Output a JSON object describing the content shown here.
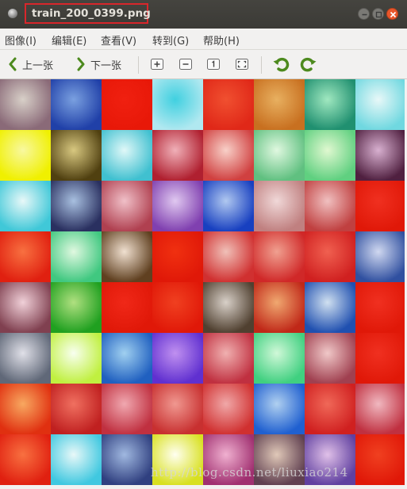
{
  "window": {
    "title": "train_200_0399.png"
  },
  "menu": {
    "items": [
      {
        "label": "图像(I)"
      },
      {
        "label": "编辑(E)"
      },
      {
        "label": "查看(V)"
      },
      {
        "label": "转到(G)"
      },
      {
        "label": "帮助(H)"
      }
    ]
  },
  "toolbar": {
    "prev_label": "上一张",
    "next_label": "下一张",
    "icons": [
      "zoom-in-icon",
      "zoom-out-icon",
      "normal-size-icon",
      "best-fit-icon",
      "rotate-left-icon",
      "rotate-right-icon"
    ]
  },
  "watermark": {
    "text": "http://blog.csdn.net/liuxiao214"
  },
  "image": {
    "rows": 8,
    "cols": 8,
    "tiles": [
      [
        [
          "#8a6a78",
          "#d8d0c8"
        ],
        [
          "#2040a8",
          "#7aa0e0"
        ],
        [
          "#e81808",
          "#f02010"
        ],
        [
          "#b0e8f0",
          "#40d0e0"
        ],
        [
          "#e02818",
          "#f05030"
        ],
        [
          "#c87020",
          "#e8b060"
        ],
        [
          "#209070",
          "#a0e8c0"
        ],
        [
          "#70d8e0",
          "#e8f8f8"
        ]
      ],
      [
        [
          "#f0f000",
          "#f8f8a0"
        ],
        [
          "#504010",
          "#d8c880"
        ],
        [
          "#40c0d0",
          "#e0f8f8"
        ],
        [
          "#b02030",
          "#f0b0b8"
        ],
        [
          "#d04040",
          "#f8d0c8"
        ],
        [
          "#60c080",
          "#e0f8e0"
        ],
        [
          "#60d080",
          "#e0f8d0"
        ],
        [
          "#502040",
          "#d8b0d0"
        ]
      ],
      [
        [
          "#40c8d8",
          "#e8f8f8"
        ],
        [
          "#2a3060",
          "#a8c0e0"
        ],
        [
          "#b04050",
          "#f0c0c8"
        ],
        [
          "#8040b0",
          "#e0c8f0"
        ],
        [
          "#1840c0",
          "#b0c8f0"
        ],
        [
          "#c08080",
          "#f0d8d8"
        ],
        [
          "#c04040",
          "#f0c0c0"
        ],
        [
          "#e01808",
          "#f03020"
        ]
      ],
      [
        [
          "#e02010",
          "#f87040"
        ],
        [
          "#40c880",
          "#e0f8e0"
        ],
        [
          "#604020",
          "#f0e0d0"
        ],
        [
          "#e01808",
          "#f03010"
        ],
        [
          "#d03030",
          "#f0c0b8"
        ],
        [
          "#d02828",
          "#f0a090"
        ],
        [
          "#d02020",
          "#f06050"
        ],
        [
          "#3050a0",
          "#d0d8f0"
        ]
      ],
      [
        [
          "#804050",
          "#f0d0d8"
        ],
        [
          "#20a020",
          "#b0e080"
        ],
        [
          "#e01808",
          "#f02818"
        ],
        [
          "#e01808",
          "#f04020"
        ],
        [
          "#504030",
          "#d8d0c8"
        ],
        [
          "#c02818",
          "#f0a870"
        ],
        [
          "#2050b0",
          "#d0e0f0"
        ],
        [
          "#e01808",
          "#f03020"
        ]
      ],
      [
        [
          "#606878",
          "#e0e0e8"
        ],
        [
          "#c0f040",
          "#f8fff0"
        ],
        [
          "#2060c0",
          "#a0d0f0"
        ],
        [
          "#6030d0",
          "#c090f0"
        ],
        [
          "#c03040",
          "#f0b0b0"
        ],
        [
          "#40d080",
          "#d0f8d8"
        ],
        [
          "#a04050",
          "#f0c8c8"
        ],
        [
          "#e01808",
          "#f03020"
        ]
      ],
      [
        [
          "#e03010",
          "#f8a860"
        ],
        [
          "#c02020",
          "#f07060"
        ],
        [
          "#c03040",
          "#f0a8b0"
        ],
        [
          "#c83030",
          "#f09890"
        ],
        [
          "#d03030",
          "#f0a8a8"
        ],
        [
          "#2060d0",
          "#b0d0f0"
        ],
        [
          "#d02020",
          "#f06858"
        ],
        [
          "#c03040",
          "#f0b8c0"
        ]
      ],
      [
        [
          "#e02010",
          "#f87040"
        ],
        [
          "#40c8e0",
          "#e8f8f8"
        ],
        [
          "#304080",
          "#a0b8e0"
        ],
        [
          "#d8e020",
          "#fffff0"
        ],
        [
          "#a03070",
          "#f0b0d0"
        ],
        [
          "#604050",
          "#e0c8b8"
        ],
        [
          "#6040a0",
          "#e0c0e8"
        ],
        [
          "#e01808",
          "#f04020"
        ]
      ]
    ]
  }
}
